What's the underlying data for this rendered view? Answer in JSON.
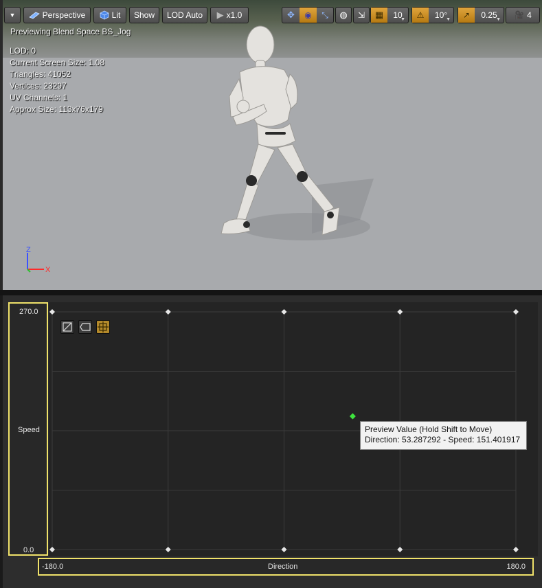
{
  "toolbar": {
    "perspective_label": "Perspective",
    "lit_label": "Lit",
    "show_label": "Show",
    "lod_label": "LOD Auto",
    "play_speed_label": "x1.0",
    "grid_size_value": "10",
    "rotation_snap_value": "10°",
    "scale_snap_value": "0.25",
    "camera_speed_value": "4",
    "accent_color": "#e0a43c"
  },
  "viewport": {
    "preview_label": "Previewing Blend Space BS_Jog",
    "stats": [
      "LOD: 0",
      "Current Screen Size: 1.08",
      "Triangles: 41052",
      "Vertices: 23297",
      "UV Channels: 1",
      "Approx Size: 113x76x179"
    ],
    "gizmo": {
      "z": "Z",
      "x": "X"
    }
  },
  "blend_space": {
    "vertical_axis": {
      "name": "Speed",
      "max": "270.0",
      "min": "0.0"
    },
    "horizontal_axis": {
      "name": "Direction",
      "min": "-180.0",
      "max": "180.0"
    },
    "preview_point": {
      "direction": 53.287292,
      "speed": 151.401917,
      "color": "#3ee33e"
    },
    "sample_points": [
      {
        "direction": -180,
        "speed": 270
      },
      {
        "direction": -90,
        "speed": 270
      },
      {
        "direction": 0,
        "speed": 270
      },
      {
        "direction": 90,
        "speed": 270
      },
      {
        "direction": 180,
        "speed": 270
      },
      {
        "direction": -180,
        "speed": 0
      },
      {
        "direction": -90,
        "speed": 0
      },
      {
        "direction": 0,
        "speed": 0
      },
      {
        "direction": 90,
        "speed": 0
      },
      {
        "direction": 180,
        "speed": 0
      }
    ],
    "tooltip": {
      "line1": "Preview Value (Hold Shift to Move)",
      "line2": "Direction: 53.287292 - Speed: 151.401917"
    },
    "highlight_color": "#f0e26a"
  },
  "icons": [
    "chevron-down-icon",
    "perspective-icon",
    "lit-icon",
    "play-icon",
    "translate-icon",
    "rotate-icon",
    "scale-icon",
    "world-icon",
    "surface-snap-icon",
    "grid-icon",
    "rotation-snap-icon",
    "scale-snap-icon",
    "camera-speed-icon",
    "triangulation-icon",
    "snap-to-grid-icon",
    "show-triangulation-icon"
  ]
}
